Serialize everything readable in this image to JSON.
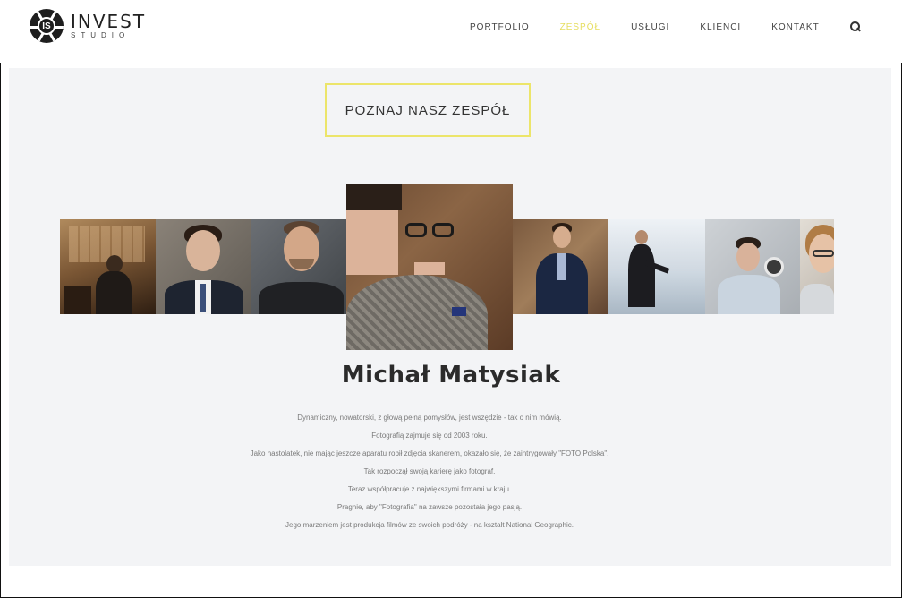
{
  "brand": {
    "mark": "IS",
    "name": "INVEST",
    "sub": "STUDIO"
  },
  "nav": {
    "items": [
      {
        "label": "PORTFOLIO",
        "active": false
      },
      {
        "label": "ZESPÓŁ",
        "active": true
      },
      {
        "label": "USŁUGI",
        "active": false
      },
      {
        "label": "KLIENCI",
        "active": false
      },
      {
        "label": "KONTAKT",
        "active": false
      }
    ],
    "search_icon": "search-icon"
  },
  "colors": {
    "accent": "#e6de5f",
    "band": "#f3f4f6",
    "text": "#2b2b2b"
  },
  "section": {
    "title": "POZNAJ NASZ ZESPÓŁ"
  },
  "member": {
    "name": "Michał Matysiak",
    "bio": [
      "Dynamiczny, nowatorski, z głową pełną pomysłów, jest wszędzie - tak o nim mówią.",
      "Fotografią zajmuje się od 2003 roku.",
      "Jako nastolatek, nie mając jeszcze aparatu robił zdjęcia skanerem, okazało się, że zaintrygowały \"FOTO Polska\".",
      "Tak rozpoczął swoją karierę jako fotograf.",
      "Teraz współpracuje z największymi firmami w kraju.",
      "Pragnie, aby \"Fotografia\" na zawsze pozostała jego pasją.",
      "Jego marzeniem jest produkcja filmów ze swoich podróży - na kształt National Geographic."
    ]
  }
}
